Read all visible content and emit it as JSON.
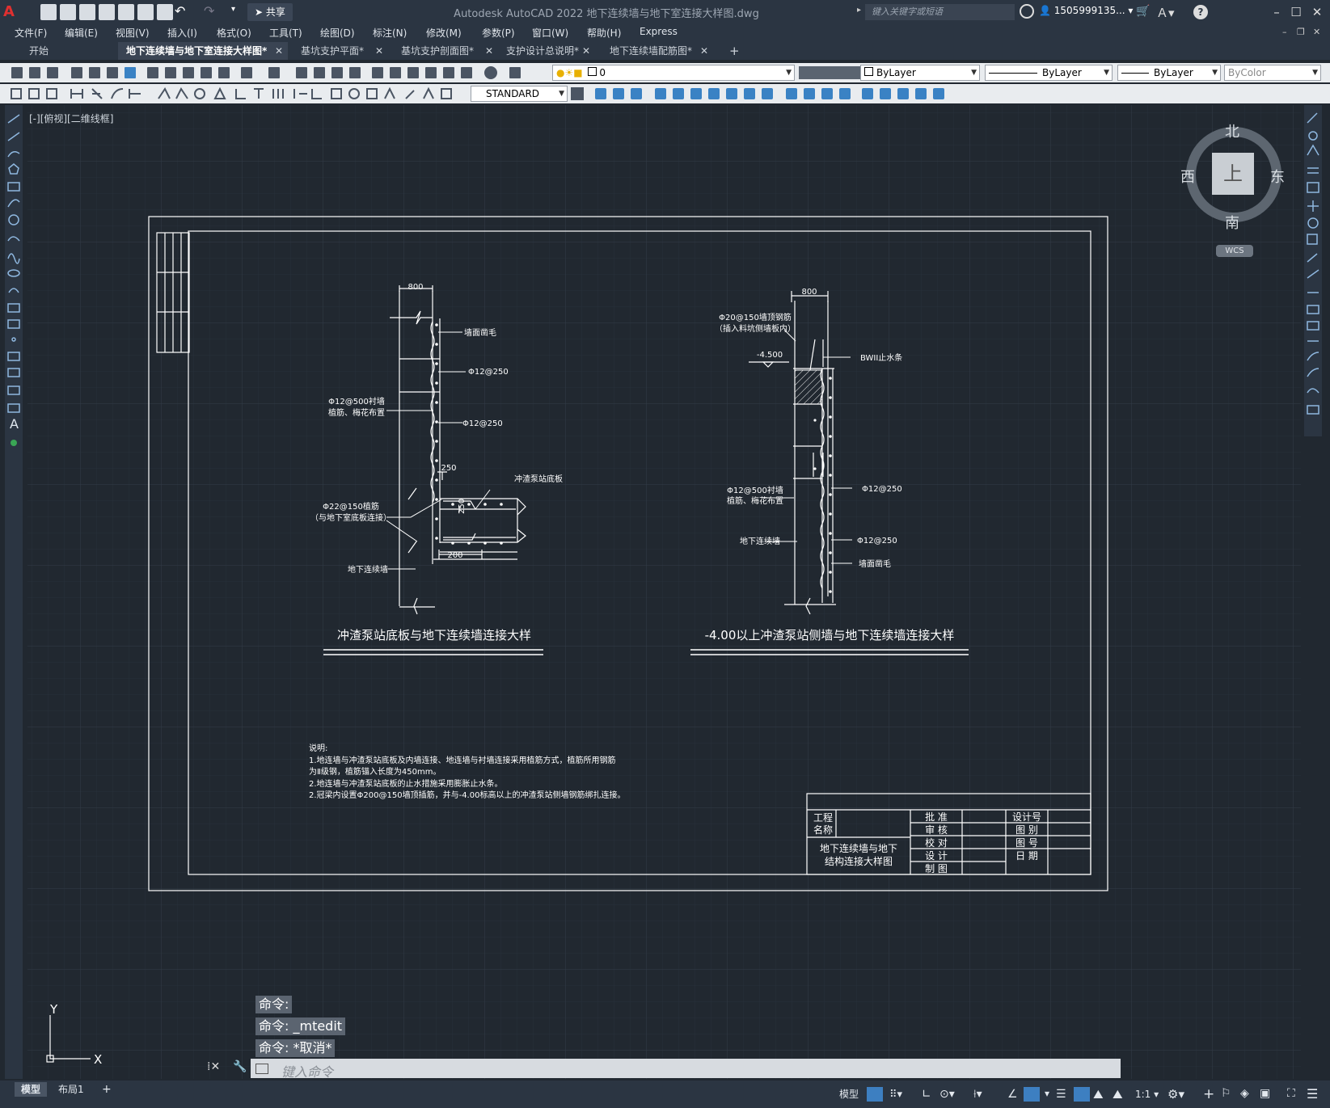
{
  "app": {
    "logo": "A",
    "title": "Autodesk AutoCAD 2022    地下连续墙与地下室连接大样图.dwg",
    "share_label": "共享",
    "search_placeholder": "键入关键字或短语",
    "user": "1505999135...",
    "help": "?"
  },
  "menus": [
    "文件(F)",
    "编辑(E)",
    "视图(V)",
    "插入(I)",
    "格式(O)",
    "工具(T)",
    "绘图(D)",
    "标注(N)",
    "修改(M)",
    "参数(P)",
    "窗口(W)",
    "帮助(H)",
    "Express"
  ],
  "tabs": [
    {
      "label": "开始",
      "active": false,
      "closable": false
    },
    {
      "label": "地下连续墙与地下室连接大样图*",
      "active": true,
      "closable": true
    },
    {
      "label": "基坑支护平面*",
      "active": false,
      "closable": true
    },
    {
      "label": "基坑支护剖面图*",
      "active": false,
      "closable": true
    },
    {
      "label": "支护设计总说明*",
      "active": false,
      "closable": true
    },
    {
      "label": "地下连续墙配筋图*",
      "active": false,
      "closable": true
    }
  ],
  "tab_add": "+",
  "properties": {
    "layer": "0",
    "color": "ByLayer",
    "linetype": "ByLayer",
    "lineweight": "ByLayer",
    "plotstyle": "ByColor",
    "textstyle": "STANDARD"
  },
  "viewport": {
    "label": "[-][俯视][二维线框]",
    "viewcube": {
      "north": "北",
      "south": "南",
      "east": "东",
      "west": "西",
      "face": "上",
      "wcs": "WCS"
    },
    "ucs": {
      "x": "X",
      "y": "Y"
    }
  },
  "drawing": {
    "detail1": {
      "title": "冲渣泵站底板与地下连续墙连接大样",
      "dim_top": "800",
      "dim_250": "250",
      "dim_250v": "250",
      "dim_200": "200",
      "labels": {
        "wall_rough": "墙面凿毛",
        "rebar1": "Φ12@250",
        "rebar2": "Φ12@250",
        "lining_rebar_1": "Φ12@500衬墙",
        "lining_rebar_2": "植筋、梅花布置",
        "slab": "冲渣泵站底板",
        "dowel_1": "Φ22@150植筋",
        "dowel_2": "（与地下室底板连接）",
        "diaphragm": "地下连续墙"
      }
    },
    "detail2": {
      "title": "-4.00以上冲渣泵站侧墙与地下连续墙连接大样",
      "dim_top": "800",
      "elev": "-4.500",
      "labels": {
        "top_rebar_1": "Φ20@150墙顶钢筋",
        "top_rebar_2": "（插入料坑侧墙板内）",
        "waterstop": "BWII止水条",
        "lining_rebar_1": "Φ12@500衬墙",
        "lining_rebar_2": "植筋、梅花布置",
        "rebar1": "Φ12@250",
        "rebar2": "Φ12@250",
        "diaphragm": "地下连续墙",
        "wall_rough": "墙面凿毛"
      }
    },
    "notes": [
      "说明:",
      "1.地连墙与冲渣泵站底板及内墙连接、地连墙与衬墙连接采用植筋方式，植筋所用钢筋",
      "为Ⅱ级钢，植筋锚入长度为450mm。",
      "2.地连墙与冲渣泵站底板的止水措施采用膨胀止水条。",
      "2.冠梁内设置Φ200@150墙顶插筋，并与-4.00标高以上的冲渣泵站侧墙钢筋绑扎连接。"
    ],
    "titleblock": {
      "project_1": "工程",
      "project_2": "名称",
      "drawing_name_1": "地下连续墙与地下",
      "drawing_name_2": "结构连接大样图",
      "roles": [
        "批  准",
        "审  核",
        "校  对",
        "设  计",
        "制  图"
      ],
      "fields": [
        "设计号",
        "图  别",
        "图  号",
        "日  期"
      ]
    }
  },
  "command": {
    "history": [
      "命令:",
      "命令: _mtedit",
      "命令: *取消*"
    ],
    "placeholder": "键入命令"
  },
  "status": {
    "layout_tabs": [
      "模型",
      "布局1"
    ],
    "add": "+",
    "model_label": "模型",
    "scale": "1:1"
  },
  "colors": {
    "background": "#212830",
    "chrome": "#2b3542",
    "toolbar": "#e9ecef",
    "drawing_line": "#ffffff",
    "grid": "#2d3642"
  }
}
